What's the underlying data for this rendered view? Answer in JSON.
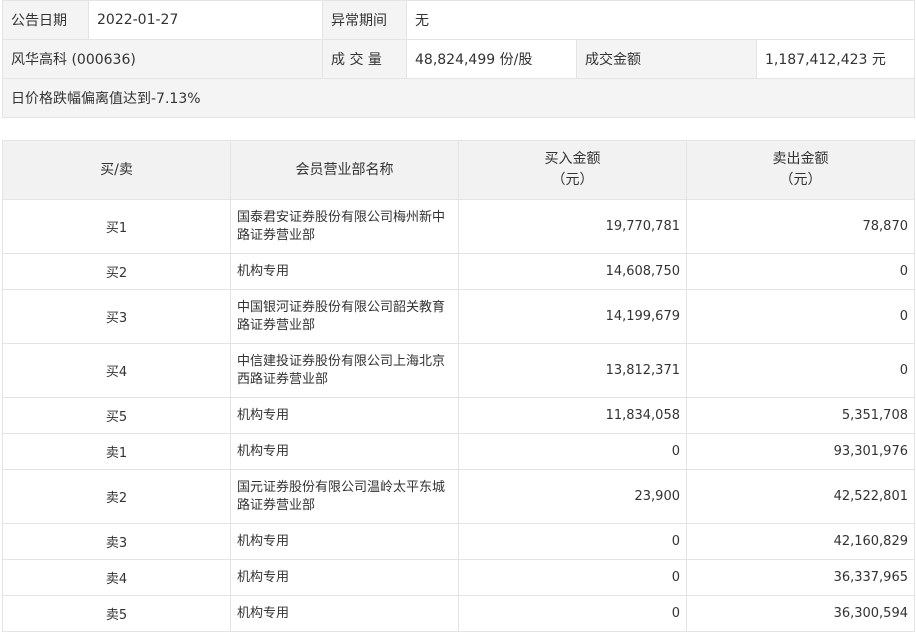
{
  "info": {
    "date_label": "公告日期",
    "date_value": "2022-01-27",
    "period_label": "异常期间",
    "period_value": "无",
    "stock": "风华高科 (000636)",
    "volume_label": "成 交 量",
    "volume_value": "48,824,499 份/股",
    "amount_label": "成交金额",
    "amount_value": "1,187,412,423 元",
    "reason": "日价格跌幅偏离值达到-7.13%"
  },
  "table": {
    "headers": {
      "side": "买/卖",
      "name": "会员营业部名称",
      "buy_line1": "买入金额",
      "buy_line2": "（元）",
      "sell_line1": "卖出金额",
      "sell_line2": "（元）"
    },
    "rows": [
      {
        "side": "买1",
        "name": "国泰君安证券股份有限公司梅州新中路证券营业部",
        "buy": "19,770,781",
        "sell": "78,870"
      },
      {
        "side": "买2",
        "name": "机构专用",
        "buy": "14,608,750",
        "sell": "0"
      },
      {
        "side": "买3",
        "name": "中国银河证券股份有限公司韶关教育路证券营业部",
        "buy": "14,199,679",
        "sell": "0"
      },
      {
        "side": "买4",
        "name": "中信建投证券股份有限公司上海北京西路证券营业部",
        "buy": "13,812,371",
        "sell": "0"
      },
      {
        "side": "买5",
        "name": "机构专用",
        "buy": "11,834,058",
        "sell": "5,351,708"
      },
      {
        "side": "卖1",
        "name": "机构专用",
        "buy": "0",
        "sell": "93,301,976"
      },
      {
        "side": "卖2",
        "name": "国元证券股份有限公司温岭太平东城路证券营业部",
        "buy": "23,900",
        "sell": "42,522,801"
      },
      {
        "side": "卖3",
        "name": "机构专用",
        "buy": "0",
        "sell": "42,160,829"
      },
      {
        "side": "卖4",
        "name": "机构专用",
        "buy": "0",
        "sell": "36,337,965"
      },
      {
        "side": "卖5",
        "name": "机构专用",
        "buy": "0",
        "sell": "36,300,594"
      }
    ]
  }
}
